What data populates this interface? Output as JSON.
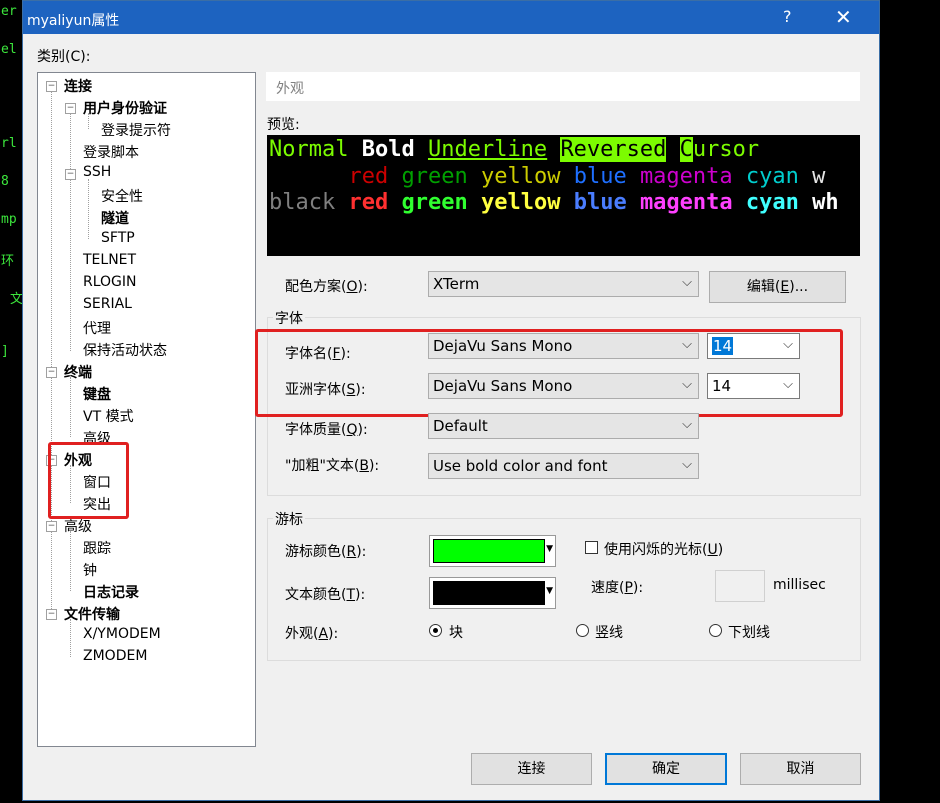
{
  "background_terminal": [
    "er",
    "el",
    "rl",
    "8",
    "mp",
    "环",
    "文",
    "]"
  ],
  "window": {
    "title": "myaliyun属性",
    "help_label": "?",
    "close_label": "✕"
  },
  "category_label": "类别(C):",
  "tree": [
    {
      "label": "连接",
      "bold": true
    },
    {
      "label": "用户身份验证",
      "bold": true
    },
    {
      "label": "登录提示符",
      "bold": false
    },
    {
      "label": "登录脚本",
      "bold": false
    },
    {
      "label": "SSH",
      "bold": false
    },
    {
      "label": "安全性",
      "bold": false
    },
    {
      "label": "隧道",
      "bold": true
    },
    {
      "label": "SFTP",
      "bold": false
    },
    {
      "label": "TELNET",
      "bold": false
    },
    {
      "label": "RLOGIN",
      "bold": false
    },
    {
      "label": "SERIAL",
      "bold": false
    },
    {
      "label": "代理",
      "bold": false
    },
    {
      "label": "保持活动状态",
      "bold": false
    },
    {
      "label": "终端",
      "bold": true
    },
    {
      "label": "键盘",
      "bold": true
    },
    {
      "label": "VT 模式",
      "bold": false
    },
    {
      "label": "高级",
      "bold": false
    },
    {
      "label": "外观",
      "bold": true
    },
    {
      "label": "窗口",
      "bold": false
    },
    {
      "label": "突出",
      "bold": false
    },
    {
      "label": "高级",
      "bold": false
    },
    {
      "label": "跟踪",
      "bold": false
    },
    {
      "label": "钟",
      "bold": false
    },
    {
      "label": "日志记录",
      "bold": true
    },
    {
      "label": "文件传输",
      "bold": true
    },
    {
      "label": "X/YMODEM",
      "bold": false
    },
    {
      "label": "ZMODEM",
      "bold": false
    }
  ],
  "header": "外观",
  "preview": {
    "label": "预览:",
    "line1": {
      "normal": "Normal",
      "bold": "Bold",
      "underline": "Underline",
      "reversed": "Reversed",
      "cursor_char": "C",
      "cursor_rest": "ursor"
    },
    "line2": [
      "red",
      "green",
      "yellow",
      "blue",
      "magenta",
      "cyan",
      "w"
    ],
    "line3": [
      "black",
      "red",
      "green",
      "yellow",
      "blue",
      "magenta",
      "cyan",
      "wh"
    ]
  },
  "color_scheme": {
    "label": "配色方案(",
    "key": "O",
    "suffix": "):",
    "value": "XTerm",
    "edit_button": "编辑(",
    "edit_key": "E",
    "edit_suffix": ")..."
  },
  "font_group": {
    "title": "字体",
    "font_name": {
      "label": "字体名(",
      "key": "F",
      "suffix": "):",
      "value": "DejaVu Sans Mono",
      "size": "14"
    },
    "asian_font": {
      "label": "亚洲字体(",
      "key": "S",
      "suffix": "):",
      "value": "DejaVu Sans Mono",
      "size": "14"
    },
    "quality": {
      "label": "字体质量(",
      "key": "Q",
      "suffix": "):",
      "value": "Default"
    },
    "bold": {
      "label": "\"加粗\"文本(",
      "key": "B",
      "suffix": "):",
      "value": "Use bold color and font"
    }
  },
  "cursor_group": {
    "title": "游标",
    "cursor_color": {
      "label": "游标颜色(",
      "key": "R",
      "suffix": "):",
      "color": "#00ff00"
    },
    "text_color": {
      "label": "文本颜色(",
      "key": "T",
      "suffix": "):",
      "color": "#000000"
    },
    "blink": {
      "label": "使用闪烁的光标(",
      "key": "U",
      "suffix": ")",
      "checked": false
    },
    "speed": {
      "label": "速度(",
      "key": "P",
      "suffix": "):",
      "unit": "millisec"
    },
    "appearance": {
      "label": "外观(",
      "key": "A",
      "suffix": "):",
      "options": [
        "块",
        "竖线",
        "下划线"
      ],
      "selected": "块"
    }
  },
  "buttons": {
    "connect": "连接",
    "ok": "确定",
    "cancel": "取消"
  },
  "colors": {
    "title_bar": "#1d63c0",
    "highlight_red": "#e02020",
    "preview_green": "#7cfc00",
    "ansi_red": "#cd0000",
    "ansi_green": "#00cd00",
    "ansi_yellow": "#cdcd00",
    "ansi_blue": "#0000ee",
    "ansi_magenta": "#cd00cd",
    "ansi_cyan": "#00cdcd"
  }
}
